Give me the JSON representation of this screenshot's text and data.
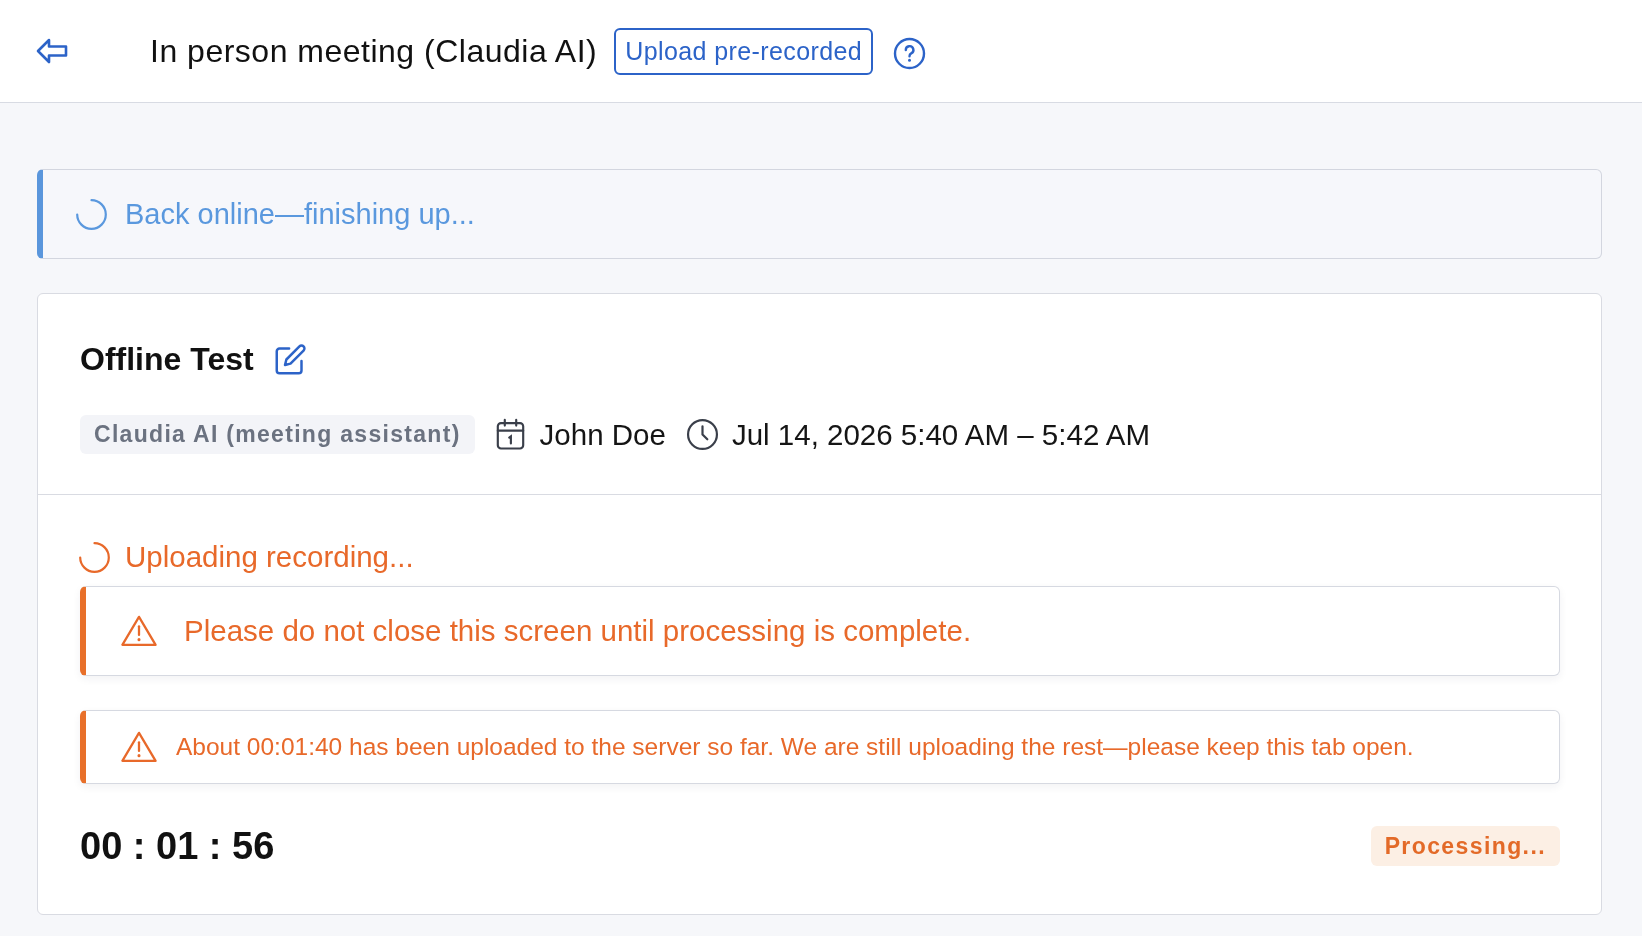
{
  "header": {
    "title": "In person meeting (Claudia AI)",
    "upload_button": "Upload pre-recorded"
  },
  "status_banner": {
    "text": "Back online—finishing up..."
  },
  "meeting": {
    "title": "Offline Test",
    "assistant_tag": "Claudia AI (meeting assistant)",
    "organizer": "John Doe",
    "time": "Jul 14, 2026 5:40 AM – 5:42 AM"
  },
  "upload": {
    "status": "Uploading recording...",
    "notice": "Please do not close this screen until processing is complete.",
    "progress_note": "About 00:01:40 has been uploaded to the server so far. We are still uploading the rest—please keep this tab open.",
    "timer": "00 : 01 : 56",
    "badge": "Processing..."
  }
}
